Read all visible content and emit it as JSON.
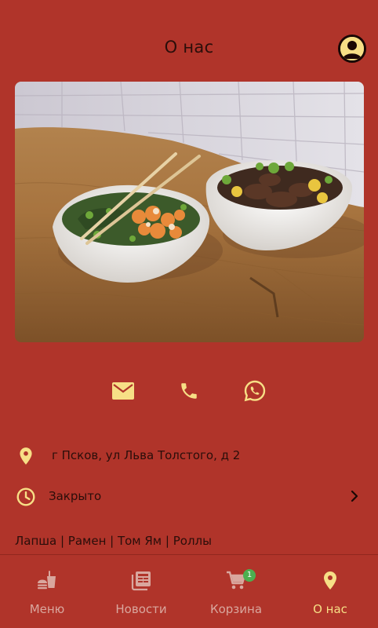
{
  "header": {
    "title": "О нас",
    "profile_icon": "account-circle-icon"
  },
  "hero": {
    "image": "noodle-bowls-photo"
  },
  "contacts": [
    {
      "icon": "email-icon"
    },
    {
      "icon": "phone-icon"
    },
    {
      "icon": "whatsapp-icon"
    }
  ],
  "info": {
    "address": "г Псков, ул Льва Толстого, д 2",
    "address_icon": "location-pin-icon",
    "hours_status": "Закрыто",
    "hours_icon": "clock-icon",
    "tags": "Лапша | Рамен | Том Ям | Роллы"
  },
  "nav": {
    "items": [
      {
        "label": "Меню",
        "icon": "food-icon"
      },
      {
        "label": "Новости",
        "icon": "news-icon"
      },
      {
        "label": "Корзина",
        "icon": "cart-icon",
        "badge": "1"
      },
      {
        "label": "О нас",
        "icon": "location-pin-icon",
        "active": true
      }
    ]
  },
  "colors": {
    "background": "#b0342a",
    "accent": "#f7df86",
    "text": "#2a0e0a",
    "nav_inactive": "#d9a79e",
    "badge": "#4caf50"
  }
}
